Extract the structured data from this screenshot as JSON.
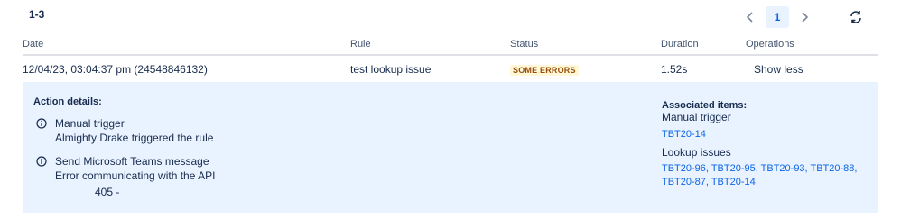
{
  "header": {
    "count": "1-3",
    "pagination": {
      "current_page": "1"
    }
  },
  "table": {
    "columns": [
      "Date",
      "Rule",
      "Status",
      "Duration",
      "Operations"
    ],
    "row": {
      "date": "12/04/23, 03:04:37 pm (24548846132)",
      "rule": "test lookup issue",
      "status": "SOME ERRORS",
      "duration": "1.52s",
      "operation": "Show less"
    }
  },
  "details": {
    "title": "Action details:",
    "actions": [
      {
        "icon": "info-icon",
        "name": "Manual trigger",
        "detail": "Almighty Drake triggered the rule"
      },
      {
        "icon": "info-icon",
        "name": "Send Microsoft Teams message",
        "detail": "Error communicating with the API",
        "code": "405 -"
      }
    ],
    "associated": {
      "title": "Associated items:",
      "groups": [
        {
          "label": "Manual trigger",
          "items_text": "TBT20-14"
        },
        {
          "label": "Lookup issues",
          "items_line1": "TBT20-96, TBT20-95, TBT20-93, TBT20-88,",
          "items_line2": "TBT20-87, TBT20-14"
        }
      ]
    }
  },
  "colors": {
    "accent": "#0c66e4",
    "details_bg": "#e9f2ff",
    "badge_bg": "#fff7d6",
    "badge_text": "#974f0c"
  }
}
